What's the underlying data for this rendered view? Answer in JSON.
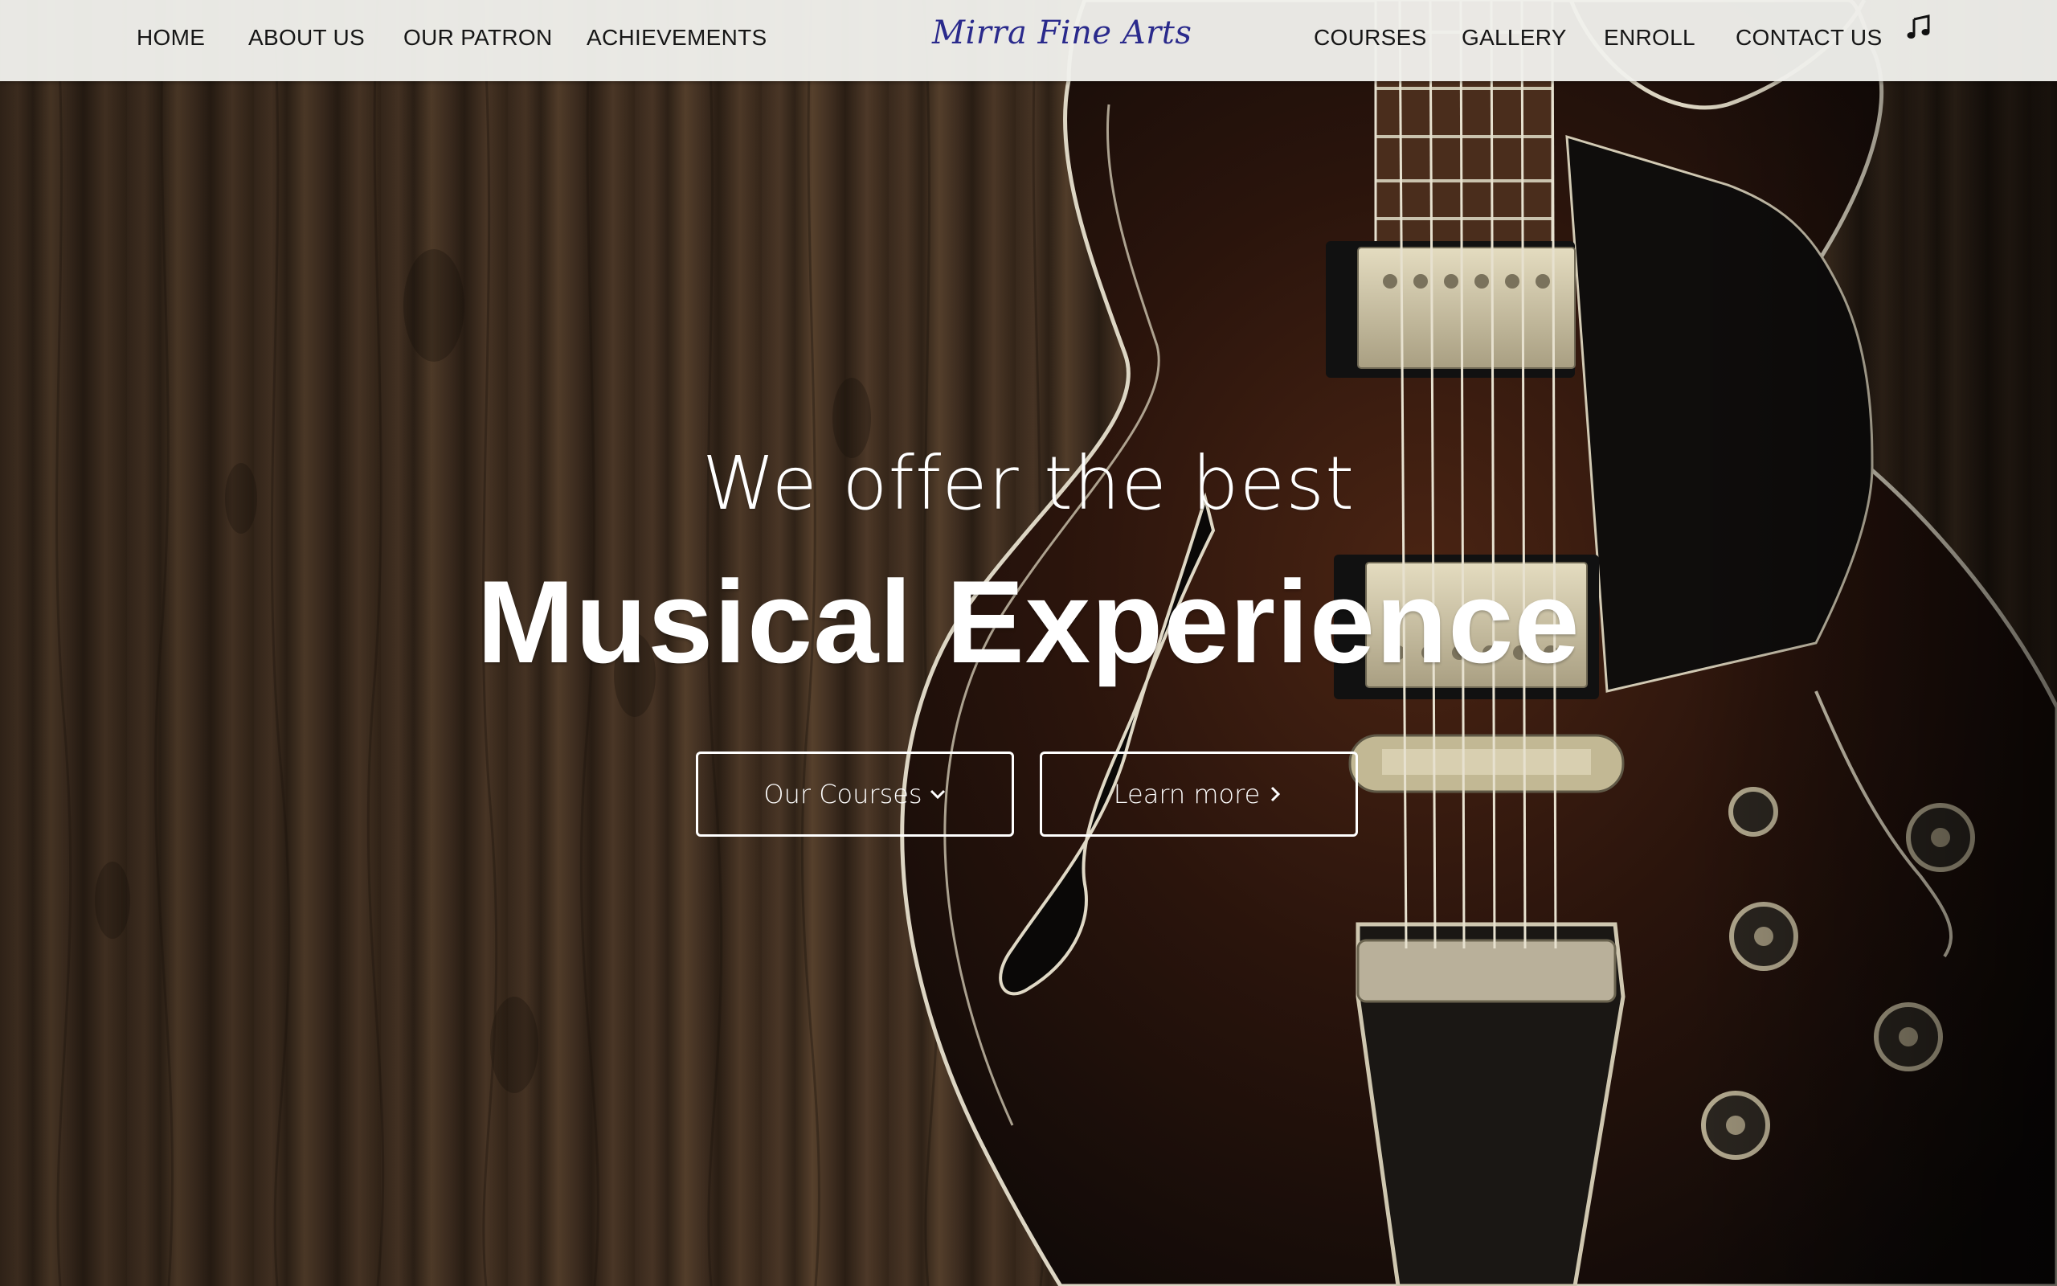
{
  "nav": {
    "left_items": [
      {
        "label": "HOME"
      },
      {
        "label": "ABOUT US"
      },
      {
        "label": "OUR PATRON"
      },
      {
        "label": "ACHIEVEMENTS"
      }
    ],
    "brand": "Mirra Fine Arts",
    "right_items": [
      {
        "label": "COURSES"
      },
      {
        "label": "GALLERY"
      },
      {
        "label": "ENROLL"
      },
      {
        "label": "CONTACT US"
      }
    ],
    "music_toggle_icon": "music-note-icon"
  },
  "hero": {
    "subheadline": "We offer the best",
    "headline": "Musical Experience",
    "buttons": {
      "courses_label": "Our Courses",
      "courses_icon": "chevron-down-icon",
      "learn_label": "Learn more",
      "learn_icon": "chevron-right-icon"
    }
  },
  "colors": {
    "nav_background": "#f0f0ec",
    "nav_text": "#161616",
    "brand": "#2a2a8c",
    "hero_text": "#ffffff"
  }
}
